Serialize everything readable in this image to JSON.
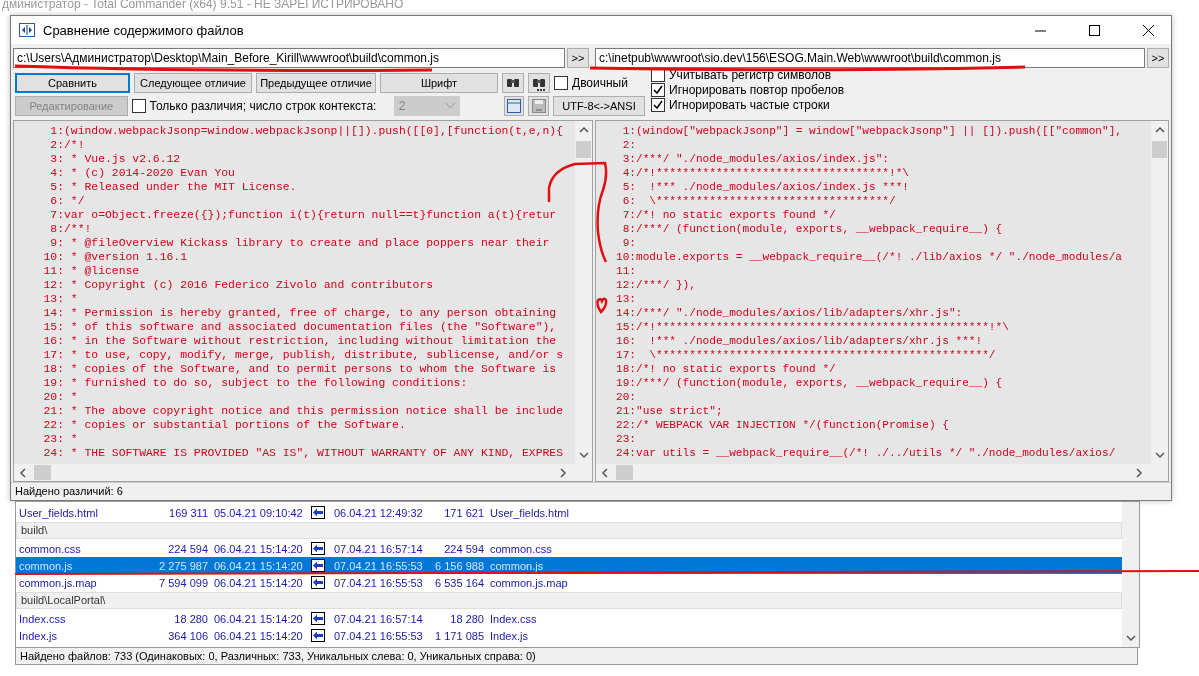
{
  "background_window": {
    "title": "дминистратор - Total Commander (x64) 9.51 - НЕ ЗАРЕГИСТРИРОВАНО"
  },
  "dialog": {
    "title": "Сравнение содержимого файлов",
    "left_path": "c:\\Users\\Администратор\\Desktop\\Main_Before_Kirill\\wwwroot\\build\\common.js",
    "right_path": "c:\\inetpub\\wwwroot\\sio.dev\\156\\ESOG.Main.Web\\wwwroot\\build\\common.js",
    "browse_label": ">>",
    "buttons": [
      {
        "label": "Сравнить",
        "disabled": false
      },
      {
        "label": "Следующее отличие",
        "disabled": false
      },
      {
        "label": "Предыдущее отличие",
        "disabled": false
      },
      {
        "label": "Шрифт",
        "disabled": false
      }
    ],
    "edit_button": {
      "label": "Редактирование",
      "disabled": true
    },
    "binary": {
      "label": "Двоичный",
      "checked": false
    },
    "only_diffs": {
      "label": "Только различия; число строк контекста:",
      "checked": false
    },
    "context_lines": {
      "value": "2",
      "disabled": true
    },
    "encoding_button": {
      "label": "UTF-8<->ANSI"
    },
    "options": [
      {
        "label": "Учитывать регистр символов",
        "checked": false
      },
      {
        "label": "Игнорировать повтор пробелов",
        "checked": true
      },
      {
        "label": "Игнорировать частые строки",
        "checked": true
      }
    ],
    "left_lines": [
      {
        "number": "1:",
        "text": "(window.webpackJsonp=window.webpackJsonp||[]).push([[0],[function(t,e,n){"
      },
      {
        "number": "2:",
        "text": "/*!"
      },
      {
        "number": "3:",
        "text": " * Vue.js v2.6.12"
      },
      {
        "number": "4:",
        "text": " * (c) 2014-2020 Evan You"
      },
      {
        "number": "5:",
        "text": " * Released under the MIT License."
      },
      {
        "number": "6:",
        "text": " */"
      },
      {
        "number": "7:",
        "text": "var o=Object.freeze({});function i(t){return null==t}function a(t){retur"
      },
      {
        "number": "8:",
        "text": "/**!"
      },
      {
        "number": "9:",
        "text": " * @fileOverview Kickass library to create and place poppers near their"
      },
      {
        "number": "10:",
        "text": " * @version 1.16.1"
      },
      {
        "number": "11:",
        "text": " * @license"
      },
      {
        "number": "12:",
        "text": " * Copyright (c) 2016 Federico Zivolo and contributors"
      },
      {
        "number": "13:",
        "text": " *"
      },
      {
        "number": "14:",
        "text": " * Permission is hereby granted, free of charge, to any person obtaining"
      },
      {
        "number": "15:",
        "text": " * of this software and associated documentation files (the \"Software\"),"
      },
      {
        "number": "16:",
        "text": " * in the Software without restriction, including without limitation the"
      },
      {
        "number": "17:",
        "text": " * to use, copy, modify, merge, publish, distribute, sublicense, and/or s"
      },
      {
        "number": "18:",
        "text": " * copies of the Software, and to permit persons to whom the Software is"
      },
      {
        "number": "19:",
        "text": " * furnished to do so, subject to the following conditions:"
      },
      {
        "number": "20:",
        "text": " *"
      },
      {
        "number": "21:",
        "text": " * The above copyright notice and this permission notice shall be include"
      },
      {
        "number": "22:",
        "text": " * copies or substantial portions of the Software."
      },
      {
        "number": "23:",
        "text": " *"
      },
      {
        "number": "24:",
        "text": " * THE SOFTWARE IS PROVIDED \"AS IS\", WITHOUT WARRANTY OF ANY KIND, EXPRES"
      }
    ],
    "right_lines": [
      {
        "number": "1:",
        "text": "(window[\"webpackJsonp\"] = window[\"webpackJsonp\"] || []).push([[\"common\"],"
      },
      {
        "number": "2:"
      },
      {
        "number": "3:",
        "text": "/***/ \"./node_modules/axios/index.js\":"
      },
      {
        "number": "4:",
        "text": "/*!***********************************!*\\"
      },
      {
        "number": "5:",
        "text": "  !*** ./node_modules/axios/index.js ***!"
      },
      {
        "number": "6:",
        "text": "  \\***********************************/"
      },
      {
        "number": "7:",
        "text": "/*! no static exports found */"
      },
      {
        "number": "8:",
        "text": "/***/ (function(module, exports, __webpack_require__) {"
      },
      {
        "number": "9:"
      },
      {
        "number": "10:",
        "text": "module.exports = __webpack_require__(/*! ./lib/axios */ \"./node_modules/a"
      },
      {
        "number": "11:"
      },
      {
        "number": "12:",
        "text": "/***/ }),"
      },
      {
        "number": "13:"
      },
      {
        "number": "14:",
        "text": "/***/ \"./node_modules/axios/lib/adapters/xhr.js\":"
      },
      {
        "number": "15:",
        "text": "/*!**************************************************!*\\"
      },
      {
        "number": "16:",
        "text": "  !*** ./node_modules/axios/lib/adapters/xhr.js ***!"
      },
      {
        "number": "17:",
        "text": "  \\**************************************************/"
      },
      {
        "number": "18:",
        "text": "/*! no static exports found */"
      },
      {
        "number": "19:",
        "text": "/***/ (function(module, exports, __webpack_require__) {"
      },
      {
        "number": "20:"
      },
      {
        "number": "21:",
        "text": "\"use strict\";"
      },
      {
        "number": "22:",
        "text": "/* WEBPACK VAR INJECTION */(function(Promise) {"
      },
      {
        "number": "23:"
      },
      {
        "number": "24:",
        "text": "var utils = __webpack_require__(/*! ./../utils */ \"./node_modules/axios/"
      }
    ],
    "status": "Найдено различий: 6"
  },
  "file_list": {
    "rows": [
      {
        "kind": "file",
        "selected": false,
        "left_name": "User_fields.html",
        "left_size": "169 311",
        "left_date": "05.04.21 09:10:42",
        "right_date": "06.04.21 12:49:32",
        "right_size": "171 621",
        "right_name": "User_fields.html"
      },
      {
        "kind": "folder",
        "selected": false,
        "path": "build\\"
      },
      {
        "kind": "file",
        "selected": false,
        "left_name": "common.css",
        "left_size": "224 594",
        "left_date": "06.04.21 15:14:20",
        "right_date": "07.04.21 16:57:14",
        "right_size": "224 594",
        "right_name": "common.css"
      },
      {
        "kind": "file",
        "selected": true,
        "left_name": "common.js",
        "left_size": "2 275 987",
        "left_date": "06.04.21 15:14:20",
        "right_date": "07.04.21 16:55:53",
        "right_size": "6 156 988",
        "right_name": "common.js"
      },
      {
        "kind": "file",
        "selected": false,
        "left_name": "common.js.map",
        "left_size": "7 594 099",
        "left_date": "06.04.21 15:14:20",
        "right_date": "07.04.21 16:55:53",
        "right_size": "6 535 164",
        "right_name": "common.js.map"
      },
      {
        "kind": "folder",
        "selected": false,
        "path": "build\\LocalPortal\\"
      },
      {
        "kind": "file",
        "selected": false,
        "left_name": "Index.css",
        "left_size": "18 280",
        "left_date": "06.04.21 15:14:20",
        "right_date": "07.04.21 16:57:14",
        "right_size": "18 280",
        "right_name": "Index.css"
      },
      {
        "kind": "file",
        "selected": false,
        "left_name": "Index.js",
        "left_size": "364 106",
        "left_date": "06.04.21 15:14:20",
        "right_date": "07.04.21 16:55:53",
        "right_size": "1 171 085",
        "right_name": "Index.js"
      }
    ],
    "status": "Найдено файлов: 733  (Одинаковых: 0, Различных: 733, Уникальных слева: 0, Уникальных справа: 0)"
  }
}
